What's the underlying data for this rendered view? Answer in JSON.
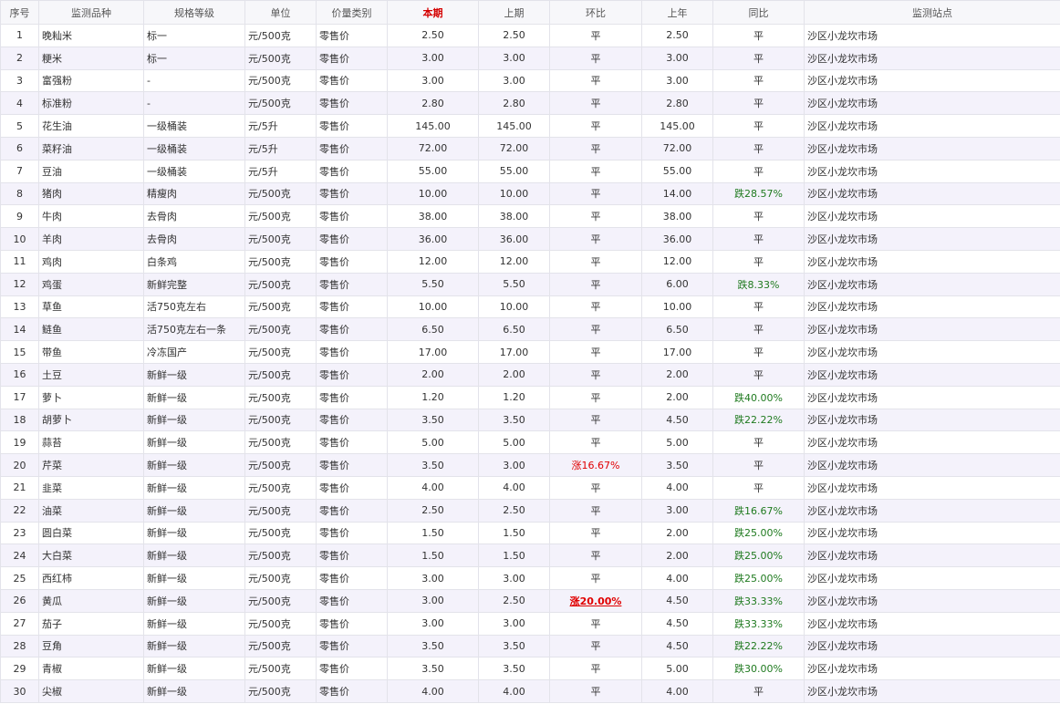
{
  "headers": [
    "序号",
    "监测品种",
    "规格等级",
    "单位",
    "价量类别",
    "本期",
    "上期",
    "环比",
    "上年",
    "同比",
    "监测站点"
  ],
  "rows": [
    [
      "1",
      "晚籼米",
      "标一",
      "元/500克",
      "零售价",
      "2.50",
      "2.50",
      "平",
      "2.50",
      "平",
      "沙区小龙坎市场"
    ],
    [
      "2",
      "粳米",
      "标一",
      "元/500克",
      "零售价",
      "3.00",
      "3.00",
      "平",
      "3.00",
      "平",
      "沙区小龙坎市场"
    ],
    [
      "3",
      "富强粉",
      "-",
      "元/500克",
      "零售价",
      "3.00",
      "3.00",
      "平",
      "3.00",
      "平",
      "沙区小龙坎市场"
    ],
    [
      "4",
      "标准粉",
      "-",
      "元/500克",
      "零售价",
      "2.80",
      "2.80",
      "平",
      "2.80",
      "平",
      "沙区小龙坎市场"
    ],
    [
      "5",
      "花生油",
      "一级桶装",
      "元/5升",
      "零售价",
      "145.00",
      "145.00",
      "平",
      "145.00",
      "平",
      "沙区小龙坎市场"
    ],
    [
      "6",
      "菜籽油",
      "一级桶装",
      "元/5升",
      "零售价",
      "72.00",
      "72.00",
      "平",
      "72.00",
      "平",
      "沙区小龙坎市场"
    ],
    [
      "7",
      "豆油",
      "一级桶装",
      "元/5升",
      "零售价",
      "55.00",
      "55.00",
      "平",
      "55.00",
      "平",
      "沙区小龙坎市场"
    ],
    [
      "8",
      "猪肉",
      "精瘦肉",
      "元/500克",
      "零售价",
      "10.00",
      "10.00",
      "平",
      "14.00",
      "跌28.57%",
      "沙区小龙坎市场"
    ],
    [
      "9",
      "牛肉",
      "去骨肉",
      "元/500克",
      "零售价",
      "38.00",
      "38.00",
      "平",
      "38.00",
      "平",
      "沙区小龙坎市场"
    ],
    [
      "10",
      "羊肉",
      "去骨肉",
      "元/500克",
      "零售价",
      "36.00",
      "36.00",
      "平",
      "36.00",
      "平",
      "沙区小龙坎市场"
    ],
    [
      "11",
      "鸡肉",
      "白条鸡",
      "元/500克",
      "零售价",
      "12.00",
      "12.00",
      "平",
      "12.00",
      "平",
      "沙区小龙坎市场"
    ],
    [
      "12",
      "鸡蛋",
      "新鲜完整",
      "元/500克",
      "零售价",
      "5.50",
      "5.50",
      "平",
      "6.00",
      "跌8.33%",
      "沙区小龙坎市场"
    ],
    [
      "13",
      "草鱼",
      "活750克左右",
      "元/500克",
      "零售价",
      "10.00",
      "10.00",
      "平",
      "10.00",
      "平",
      "沙区小龙坎市场"
    ],
    [
      "14",
      "鲢鱼",
      "活750克左右一条",
      "元/500克",
      "零售价",
      "6.50",
      "6.50",
      "平",
      "6.50",
      "平",
      "沙区小龙坎市场"
    ],
    [
      "15",
      "带鱼",
      "冷冻国产",
      "元/500克",
      "零售价",
      "17.00",
      "17.00",
      "平",
      "17.00",
      "平",
      "沙区小龙坎市场"
    ],
    [
      "16",
      "土豆",
      "新鲜一级",
      "元/500克",
      "零售价",
      "2.00",
      "2.00",
      "平",
      "2.00",
      "平",
      "沙区小龙坎市场"
    ],
    [
      "17",
      "萝卜",
      "新鲜一级",
      "元/500克",
      "零售价",
      "1.20",
      "1.20",
      "平",
      "2.00",
      "跌40.00%",
      "沙区小龙坎市场"
    ],
    [
      "18",
      "胡萝卜",
      "新鲜一级",
      "元/500克",
      "零售价",
      "3.50",
      "3.50",
      "平",
      "4.50",
      "跌22.22%",
      "沙区小龙坎市场"
    ],
    [
      "19",
      "蒜苔",
      "新鲜一级",
      "元/500克",
      "零售价",
      "5.00",
      "5.00",
      "平",
      "5.00",
      "平",
      "沙区小龙坎市场"
    ],
    [
      "20",
      "芹菜",
      "新鲜一级",
      "元/500克",
      "零售价",
      "3.50",
      "3.00",
      "涨16.67%",
      "3.50",
      "平",
      "沙区小龙坎市场"
    ],
    [
      "21",
      "韭菜",
      "新鲜一级",
      "元/500克",
      "零售价",
      "4.00",
      "4.00",
      "平",
      "4.00",
      "平",
      "沙区小龙坎市场"
    ],
    [
      "22",
      "油菜",
      "新鲜一级",
      "元/500克",
      "零售价",
      "2.50",
      "2.50",
      "平",
      "3.00",
      "跌16.67%",
      "沙区小龙坎市场"
    ],
    [
      "23",
      "圆白菜",
      "新鲜一级",
      "元/500克",
      "零售价",
      "1.50",
      "1.50",
      "平",
      "2.00",
      "跌25.00%",
      "沙区小龙坎市场"
    ],
    [
      "24",
      "大白菜",
      "新鲜一级",
      "元/500克",
      "零售价",
      "1.50",
      "1.50",
      "平",
      "2.00",
      "跌25.00%",
      "沙区小龙坎市场"
    ],
    [
      "25",
      "西红柿",
      "新鲜一级",
      "元/500克",
      "零售价",
      "3.00",
      "3.00",
      "平",
      "4.00",
      "跌25.00%",
      "沙区小龙坎市场"
    ],
    [
      "26",
      "黄瓜",
      "新鲜一级",
      "元/500克",
      "零售价",
      "3.00",
      "2.50",
      "涨20.00%",
      "4.50",
      "跌33.33%",
      "沙区小龙坎市场"
    ],
    [
      "27",
      "茄子",
      "新鲜一级",
      "元/500克",
      "零售价",
      "3.00",
      "3.00",
      "平",
      "4.50",
      "跌33.33%",
      "沙区小龙坎市场"
    ],
    [
      "28",
      "豆角",
      "新鲜一级",
      "元/500克",
      "零售价",
      "3.50",
      "3.50",
      "平",
      "4.50",
      "跌22.22%",
      "沙区小龙坎市场"
    ],
    [
      "29",
      "青椒",
      "新鲜一级",
      "元/500克",
      "零售价",
      "3.50",
      "3.50",
      "平",
      "5.00",
      "跌30.00%",
      "沙区小龙坎市场"
    ],
    [
      "30",
      "尖椒",
      "新鲜一级",
      "元/500克",
      "零售价",
      "4.00",
      "4.00",
      "平",
      "4.00",
      "平",
      "沙区小龙坎市场"
    ]
  ],
  "colors": {
    "rise": "#e00000",
    "fall": "#1f7a1f",
    "current_header": "#d40000"
  }
}
